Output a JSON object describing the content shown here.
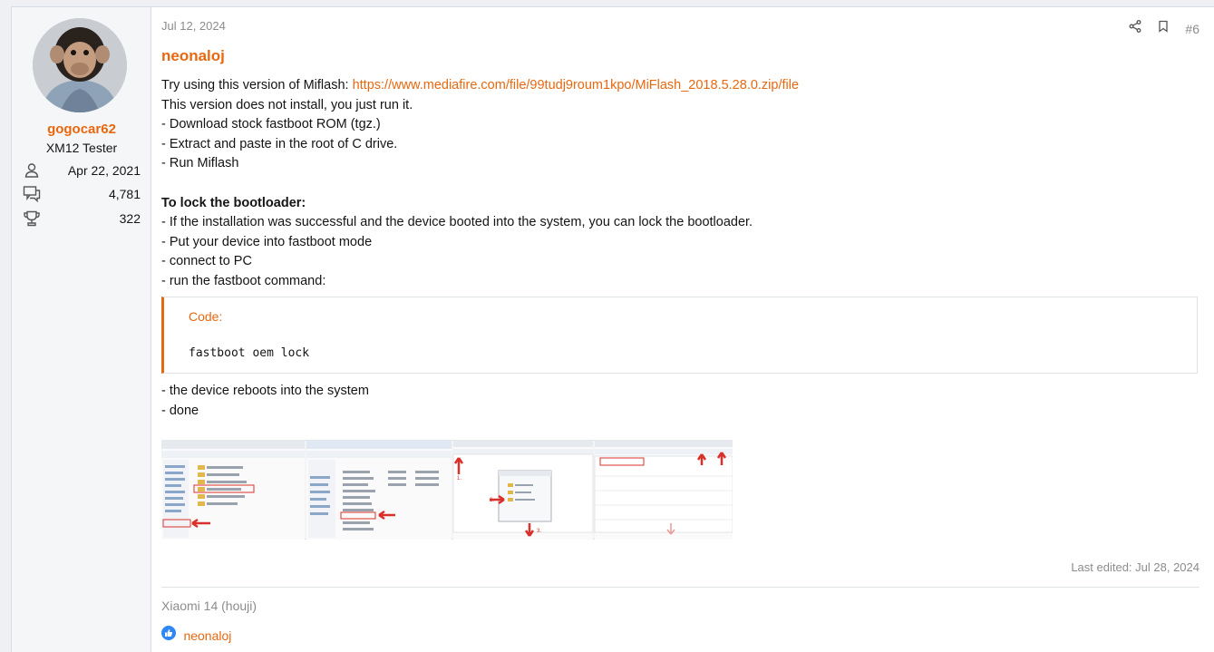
{
  "user": {
    "name": "gogocar62",
    "title": "XM12 Tester",
    "stats": [
      {
        "icon": "user-icon",
        "value": "Apr 22, 2021"
      },
      {
        "icon": "messages-icon",
        "value": "4,781"
      },
      {
        "icon": "trophy-icon",
        "value": "322"
      }
    ]
  },
  "post": {
    "date": "Jul 12, 2024",
    "number": "#6",
    "author": "neonaloj",
    "intro": "Try using this version of Miflash: ",
    "link": "https://www.mediafire.com/file/99tudj9roum1kpo/MiFlash_2018.5.28.0.zip/file",
    "lines": [
      "This version does not install, you just run it.",
      "- Download stock fastboot ROM (tgz.)",
      "- Extract and paste in the root of C drive.",
      "- Run Miflash"
    ],
    "heading": "To lock the bootloader:",
    "steps": [
      "- If the installation was successful and the device booted into the system, you can lock the bootloader.",
      "- Put your device into fastboot mode",
      "- connect to PC",
      "- run the fastboot command:"
    ],
    "code": {
      "label": "Code:",
      "text": "fastboot oem lock"
    },
    "after": [
      "- the device reboots into the system",
      "- done"
    ],
    "edited": "Last edited: Jul 28, 2024",
    "signature": "Xiaomi 14 (houji)",
    "reaction_user": "neonaloj"
  },
  "colors": {
    "accent": "#e8680f",
    "muted": "#8c8c8c"
  }
}
